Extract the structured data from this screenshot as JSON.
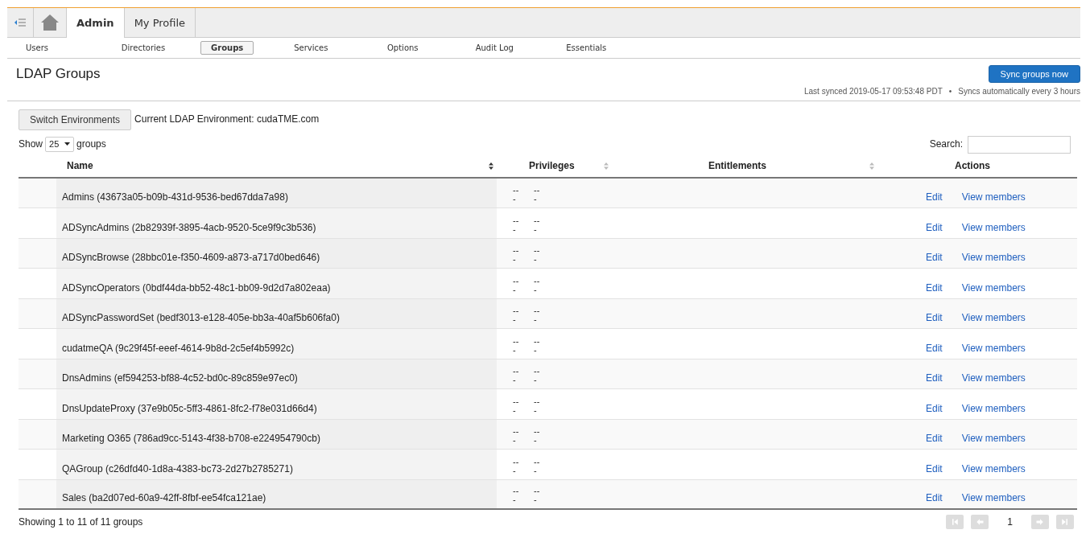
{
  "top_tabs": [
    {
      "kind": "collapse",
      "selected": false
    },
    {
      "kind": "home",
      "selected": false
    },
    {
      "kind": "text",
      "label": "Admin",
      "selected": true
    },
    {
      "kind": "text",
      "label": "My Profile",
      "selected": false
    }
  ],
  "sub_nav": [
    {
      "label": "Users",
      "selected": false
    },
    {
      "label": "Directories",
      "selected": false
    },
    {
      "label": "Groups",
      "selected": true
    },
    {
      "label": "Services",
      "selected": false
    },
    {
      "label": "Options",
      "selected": false
    },
    {
      "label": "Audit Log",
      "selected": false
    },
    {
      "label": "Essentials",
      "selected": false
    }
  ],
  "page_title": "LDAP Groups",
  "sync_button": "Sync groups now",
  "sync_status": {
    "last_synced": "Last synced 2019-05-17 09:53:48 PDT",
    "separator": "•",
    "schedule": "Syncs automatically every 3 hours"
  },
  "switch_button": "Switch Environments",
  "environment": "Current LDAP Environment: cudaTME.com",
  "page_size": {
    "before": "Show",
    "value": "25",
    "after": "groups"
  },
  "search": {
    "label": "Search:"
  },
  "table": {
    "columns": [
      {
        "label": "Name",
        "sorted": true
      },
      {
        "label": "Privileges",
        "sorted": false
      },
      {
        "label": "Entitlements",
        "sorted": false
      },
      {
        "label": "Actions"
      }
    ],
    "rows": [
      {
        "name": "Admins (43673a05-b09b-431d-9536-bed67dda7a98)",
        "privileges": [
          [
            "--",
            "-"
          ],
          [
            "--",
            "-"
          ]
        ],
        "actions": [
          "Edit",
          "View members"
        ]
      },
      {
        "name": "ADSyncAdmins (2b82939f-3895-4acb-9520-5ce9f9c3b536)",
        "privileges": [
          [
            "--",
            "-"
          ],
          [
            "--",
            "-"
          ]
        ],
        "actions": [
          "Edit",
          "View members"
        ]
      },
      {
        "name": "ADSyncBrowse (28bbc01e-f350-4609-a873-a717d0bed646)",
        "privileges": [
          [
            "--",
            "-"
          ],
          [
            "--",
            "-"
          ]
        ],
        "actions": [
          "Edit",
          "View members"
        ]
      },
      {
        "name": "ADSyncOperators (0bdf44da-bb52-48c1-bb09-9d2d7a802eaa)",
        "privileges": [
          [
            "--",
            "-"
          ],
          [
            "--",
            "-"
          ]
        ],
        "actions": [
          "Edit",
          "View members"
        ]
      },
      {
        "name": "ADSyncPasswordSet (bedf3013-e128-405e-bb3a-40af5b606fa0)",
        "privileges": [
          [
            "--",
            "-"
          ],
          [
            "--",
            "-"
          ]
        ],
        "actions": [
          "Edit",
          "View members"
        ]
      },
      {
        "name": "cudatmeQA (9c29f45f-eeef-4614-9b8d-2c5ef4b5992c)",
        "privileges": [
          [
            "--",
            "-"
          ],
          [
            "--",
            "-"
          ]
        ],
        "actions": [
          "Edit",
          "View members"
        ]
      },
      {
        "name": "DnsAdmins (ef594253-bf88-4c52-bd0c-89c859e97ec0)",
        "privileges": [
          [
            "--",
            "-"
          ],
          [
            "--",
            "-"
          ]
        ],
        "actions": [
          "Edit",
          "View members"
        ]
      },
      {
        "name": "DnsUpdateProxy (37e9b05c-5ff3-4861-8fc2-f78e031d66d4)",
        "privileges": [
          [
            "--",
            "-"
          ],
          [
            "--",
            "-"
          ]
        ],
        "actions": [
          "Edit",
          "View members"
        ]
      },
      {
        "name": "Marketing O365 (786ad9cc-5143-4f38-b708-e224954790cb)",
        "privileges": [
          [
            "--",
            "-"
          ],
          [
            "--",
            "-"
          ]
        ],
        "actions": [
          "Edit",
          "View members"
        ]
      },
      {
        "name": "QAGroup (c26dfd40-1d8a-4383-bc73-2d27b2785271)",
        "privileges": [
          [
            "--",
            "-"
          ],
          [
            "--",
            "-"
          ]
        ],
        "actions": [
          "Edit",
          "View members"
        ]
      },
      {
        "name": "Sales (ba2d07ed-60a9-42ff-8fbf-ee54fca121ae)",
        "privileges": [
          [
            "--",
            "-"
          ],
          [
            "--",
            "-"
          ]
        ],
        "actions": [
          "Edit",
          "View members"
        ]
      }
    ]
  },
  "summary": "Showing 1 to 11 of 11 groups",
  "pagination": {
    "buttons": [
      {
        "kind": "first",
        "disabled": true
      },
      {
        "kind": "previous",
        "disabled": true
      },
      {
        "kind": "next",
        "disabled": true
      },
      {
        "kind": "last",
        "disabled": true
      }
    ],
    "page": "1"
  }
}
